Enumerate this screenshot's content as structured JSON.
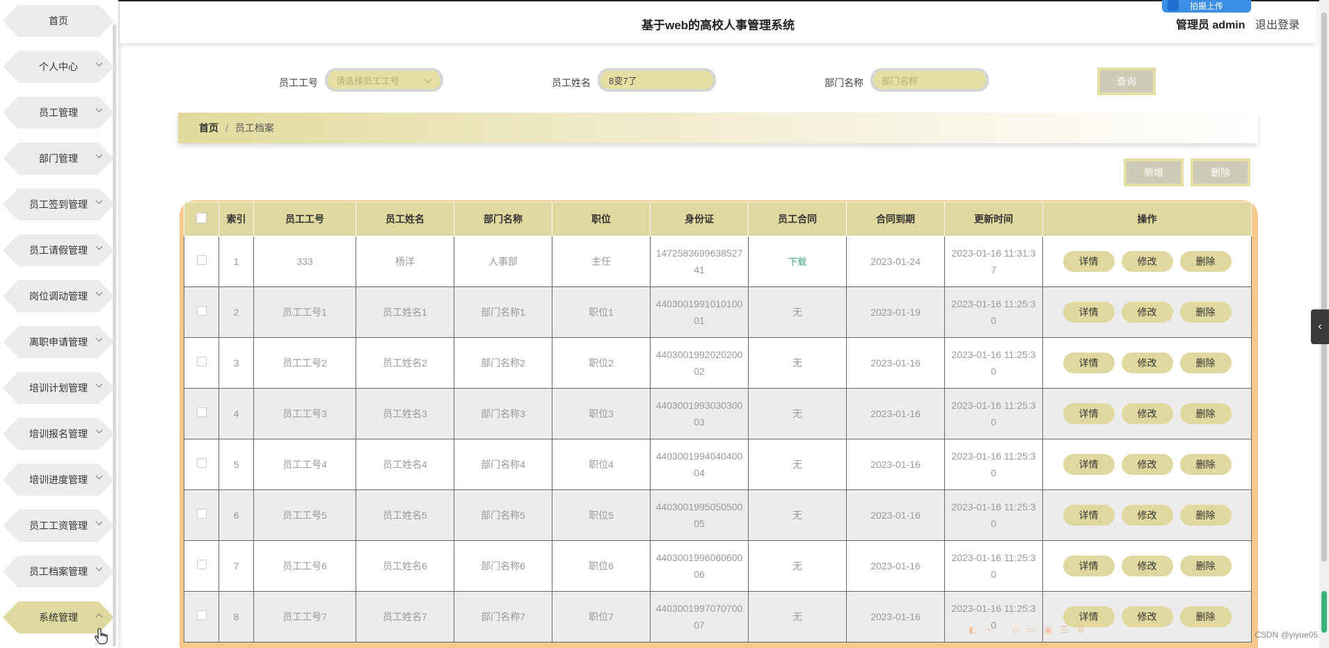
{
  "sidebar": {
    "items": [
      {
        "label": "首页"
      },
      {
        "label": "个人中心"
      },
      {
        "label": "员工管理"
      },
      {
        "label": "部门管理"
      },
      {
        "label": "员工签到管理"
      },
      {
        "label": "员工请假管理"
      },
      {
        "label": "岗位调动管理"
      },
      {
        "label": "离职申请管理"
      },
      {
        "label": "培训计划管理"
      },
      {
        "label": "培训报名管理"
      },
      {
        "label": "培训进度管理"
      },
      {
        "label": "员工工资管理"
      },
      {
        "label": "员工档案管理"
      },
      {
        "label": "系统管理"
      }
    ],
    "active_index": 13
  },
  "header": {
    "title": "基于web的高校人事管理系统",
    "admin_label": "管理员 admin",
    "logout_label": "退出登录",
    "upload_label": "拍摄上传"
  },
  "search": {
    "emp_no_label": "员工工号",
    "emp_no_placeholder": "请选择员工工号",
    "emp_name_label": "员工姓名",
    "emp_name_value": "8变7了",
    "dept_label": "部门名称",
    "dept_placeholder": "部门名称",
    "query_label": "查询"
  },
  "breadcrumb": {
    "home": "首页",
    "separator": "/",
    "current": "员工档案"
  },
  "actions": {
    "add_label": "新增",
    "delete_label": "删除"
  },
  "table": {
    "headers": [
      "索引",
      "员工工号",
      "员工姓名",
      "部门名称",
      "职位",
      "身份证",
      "员工合同",
      "合同到期",
      "更新时间",
      "操作"
    ],
    "row_buttons": {
      "detail": "详情",
      "edit": "修改",
      "delete": "删除"
    },
    "rows": [
      {
        "index": "1",
        "emp_no": "333",
        "name": "杨洋",
        "dept": "人事部",
        "position": "主任",
        "id_card": "147258369963852741",
        "contract": "下载",
        "expire": "2023-01-24",
        "updated": "2023-01-16 11:31:37"
      },
      {
        "index": "2",
        "emp_no": "员工工号1",
        "name": "员工姓名1",
        "dept": "部门名称1",
        "position": "职位1",
        "id_card": "440300199101010001",
        "contract": "无",
        "expire": "2023-01-19",
        "updated": "2023-01-16 11:25:30"
      },
      {
        "index": "3",
        "emp_no": "员工工号2",
        "name": "员工姓名2",
        "dept": "部门名称2",
        "position": "职位2",
        "id_card": "440300199202020002",
        "contract": "无",
        "expire": "2023-01-16",
        "updated": "2023-01-16 11:25:30"
      },
      {
        "index": "4",
        "emp_no": "员工工号3",
        "name": "员工姓名3",
        "dept": "部门名称3",
        "position": "职位3",
        "id_card": "440300199303030003",
        "contract": "无",
        "expire": "2023-01-16",
        "updated": "2023-01-16 11:25:30"
      },
      {
        "index": "5",
        "emp_no": "员工工号4",
        "name": "员工姓名4",
        "dept": "部门名称4",
        "position": "职位4",
        "id_card": "440300199404040004",
        "contract": "无",
        "expire": "2023-01-16",
        "updated": "2023-01-16 11:25:30"
      },
      {
        "index": "6",
        "emp_no": "员工工号5",
        "name": "员工姓名5",
        "dept": "部门名称5",
        "position": "职位5",
        "id_card": "440300199505050005",
        "contract": "无",
        "expire": "2023-01-16",
        "updated": "2023-01-16 11:25:30"
      },
      {
        "index": "7",
        "emp_no": "员工工号6",
        "name": "员工姓名6",
        "dept": "部门名称6",
        "position": "职位6",
        "id_card": "440300199606060006",
        "contract": "无",
        "expire": "2023-01-16",
        "updated": "2023-01-16 11:25:30"
      },
      {
        "index": "8",
        "emp_no": "员工工号7",
        "name": "员工姓名7",
        "dept": "部门名称7",
        "position": "职位7",
        "id_card": "440300199707070007",
        "contract": "无",
        "expire": "2023-01-16",
        "updated": "2023-01-16 11:25:30"
      }
    ]
  },
  "footer": {
    "watermark": "CSDN @yiyue05"
  },
  "colors": {
    "accent": "#e0d89e",
    "table_frame": "#f8c98c",
    "download_link": "#3aa98a"
  }
}
